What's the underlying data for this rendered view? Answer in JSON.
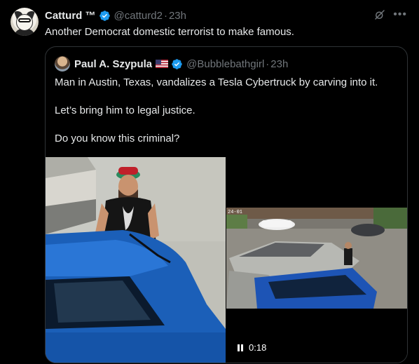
{
  "tweet": {
    "author_name": "Catturd ™",
    "author_handle": "@catturd2",
    "separator": "·",
    "time": "23h",
    "text": "Another Democrat domestic terrorist to make famous."
  },
  "quote": {
    "author_name": "Paul A. Szypula",
    "author_handle": "@Bubblebathgirl",
    "separator": "·",
    "time": "23h",
    "paragraphs": [
      "Man in Austin, Texas, vandalizes a Tesla Cybertruck by carving into it.",
      "Let’s bring him to legal justice.",
      "Do you know this criminal?"
    ],
    "video_duration": "0:18",
    "cctv_timestamp": "24-01"
  },
  "colors": {
    "background": "#000000",
    "text_primary": "#e7e9ea",
    "text_secondary": "#71767b",
    "verified_blue": "#1d9bf0",
    "border": "#2f3336"
  },
  "icons": [
    "verified-badge-icon",
    "grok-icon",
    "more-icon",
    "us-flag-icon",
    "pause-icon"
  ]
}
